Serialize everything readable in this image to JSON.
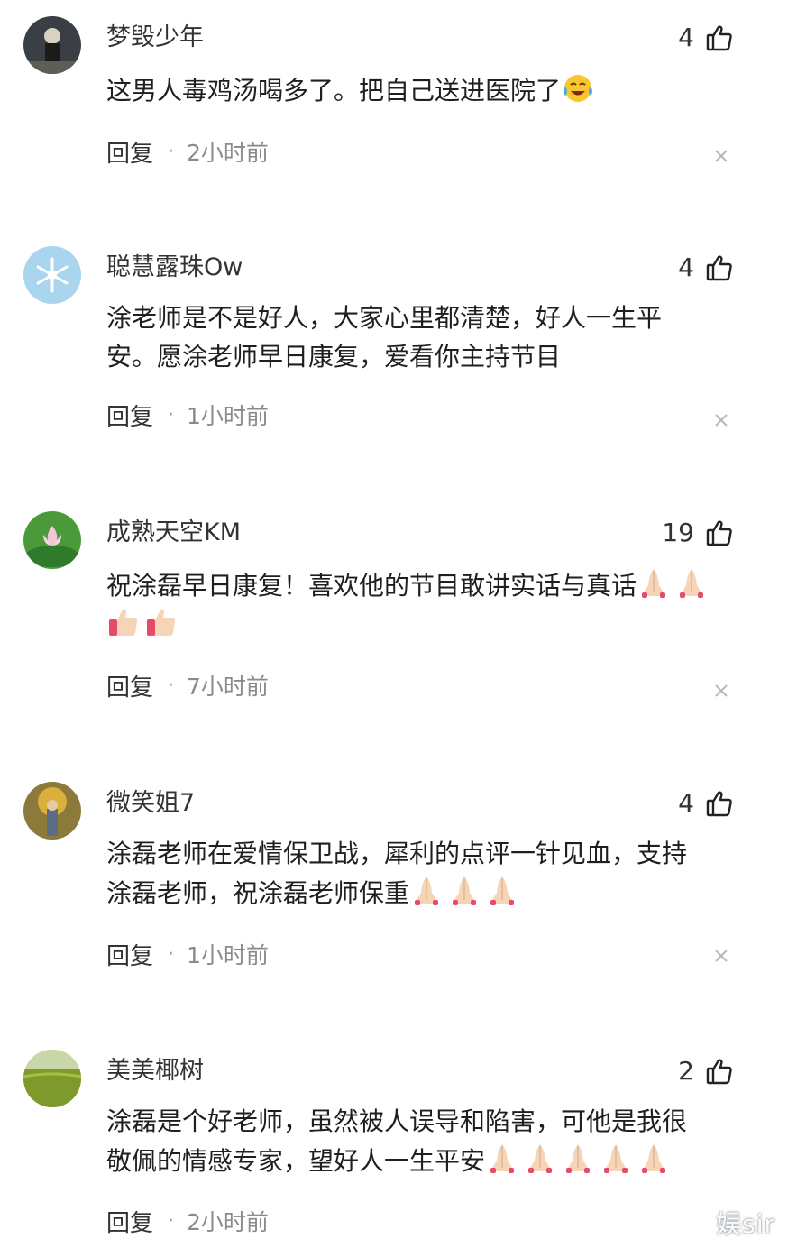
{
  "comments": [
    {
      "user": "梦毁少年",
      "likes": "4",
      "lines": [
        "这男人毒鸡汤喝多了。把自己送进医院了"
      ],
      "emoji": "face-with-tears-of-joy",
      "reply_label": "回复",
      "separator": "·",
      "time": "2小时前"
    },
    {
      "user": "聪慧露珠Ow",
      "likes": "4",
      "lines": [
        "涂老师是不是好人，大家心里都清楚，好人一生平",
        "安。愿涂老师早日康复，爱看你主持节目"
      ],
      "emoji": "",
      "reply_label": "回复",
      "separator": "·",
      "time": "1小时前"
    },
    {
      "user": "成熟天空KM",
      "likes": "19",
      "lines": [
        "祝涂磊早日康复！喜欢他的节目敢讲实话与真话"
      ],
      "emoji": "folded-hands x2, thumbs-up x2",
      "reply_label": "回复",
      "separator": "·",
      "time": "7小时前"
    },
    {
      "user": "微笑姐7",
      "likes": "4",
      "lines": [
        "涂磊老师在爱情保卫战，犀利的点评一针见血，支持",
        "涂磊老师，祝涂磊老师保重"
      ],
      "emoji": "folded-hands x3",
      "reply_label": "回复",
      "separator": "·",
      "time": "1小时前"
    },
    {
      "user": "美美椰树",
      "likes": "2",
      "lines": [
        "涂磊是个好老师，虽然被人误导和陷害，可他是我很",
        "敬佩的情感专家，望好人一生平安"
      ],
      "emoji": "folded-hands x5",
      "reply_label": "回复",
      "separator": "·",
      "time": "2小时前"
    }
  ],
  "watermark": "娱sir",
  "colors": {
    "text": "#1f1f1f",
    "meta": "#8a8a8a",
    "background": "#ffffff"
  }
}
